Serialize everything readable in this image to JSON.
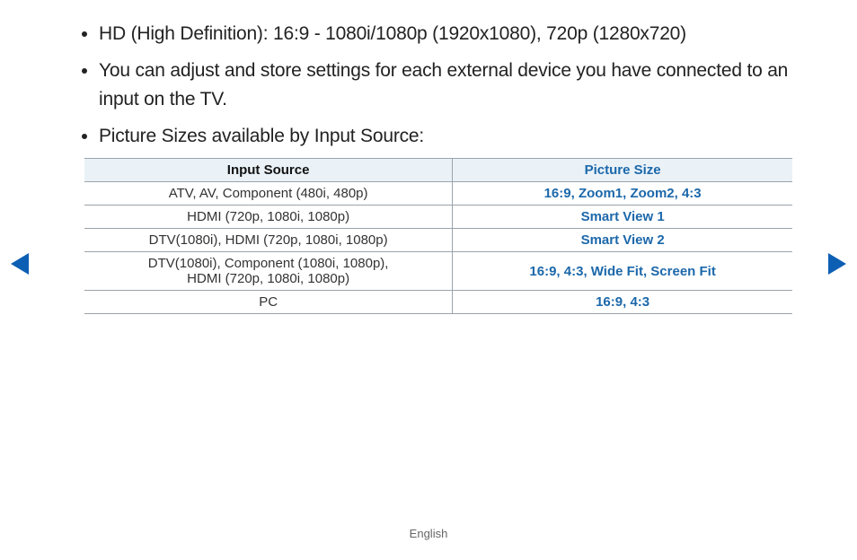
{
  "bullets": [
    "HD (High Definition): 16:9 - 1080i/1080p (1920x1080), 720p (1280x720)",
    "You can adjust and store settings for each external device you have connected to an input on the TV.",
    "Picture Sizes available by Input Source:"
  ],
  "table": {
    "headers": {
      "input": "Input Source",
      "size": "Picture Size"
    },
    "rows": [
      {
        "input": "ATV, AV, Component (480i, 480p)",
        "size": "16:9, Zoom1, Zoom2, 4:3"
      },
      {
        "input": "HDMI (720p, 1080i, 1080p)",
        "size": "Smart View 1"
      },
      {
        "input": "DTV(1080i), HDMI (720p, 1080i, 1080p)",
        "size": "Smart View 2"
      },
      {
        "input": "DTV(1080i), Component (1080i, 1080p),\nHDMI (720p, 1080i, 1080p)",
        "size": "16:9, 4:3, Wide Fit, Screen Fit"
      },
      {
        "input": "PC",
        "size": "16:9, 4:3"
      }
    ]
  },
  "footer": {
    "language": "English"
  }
}
